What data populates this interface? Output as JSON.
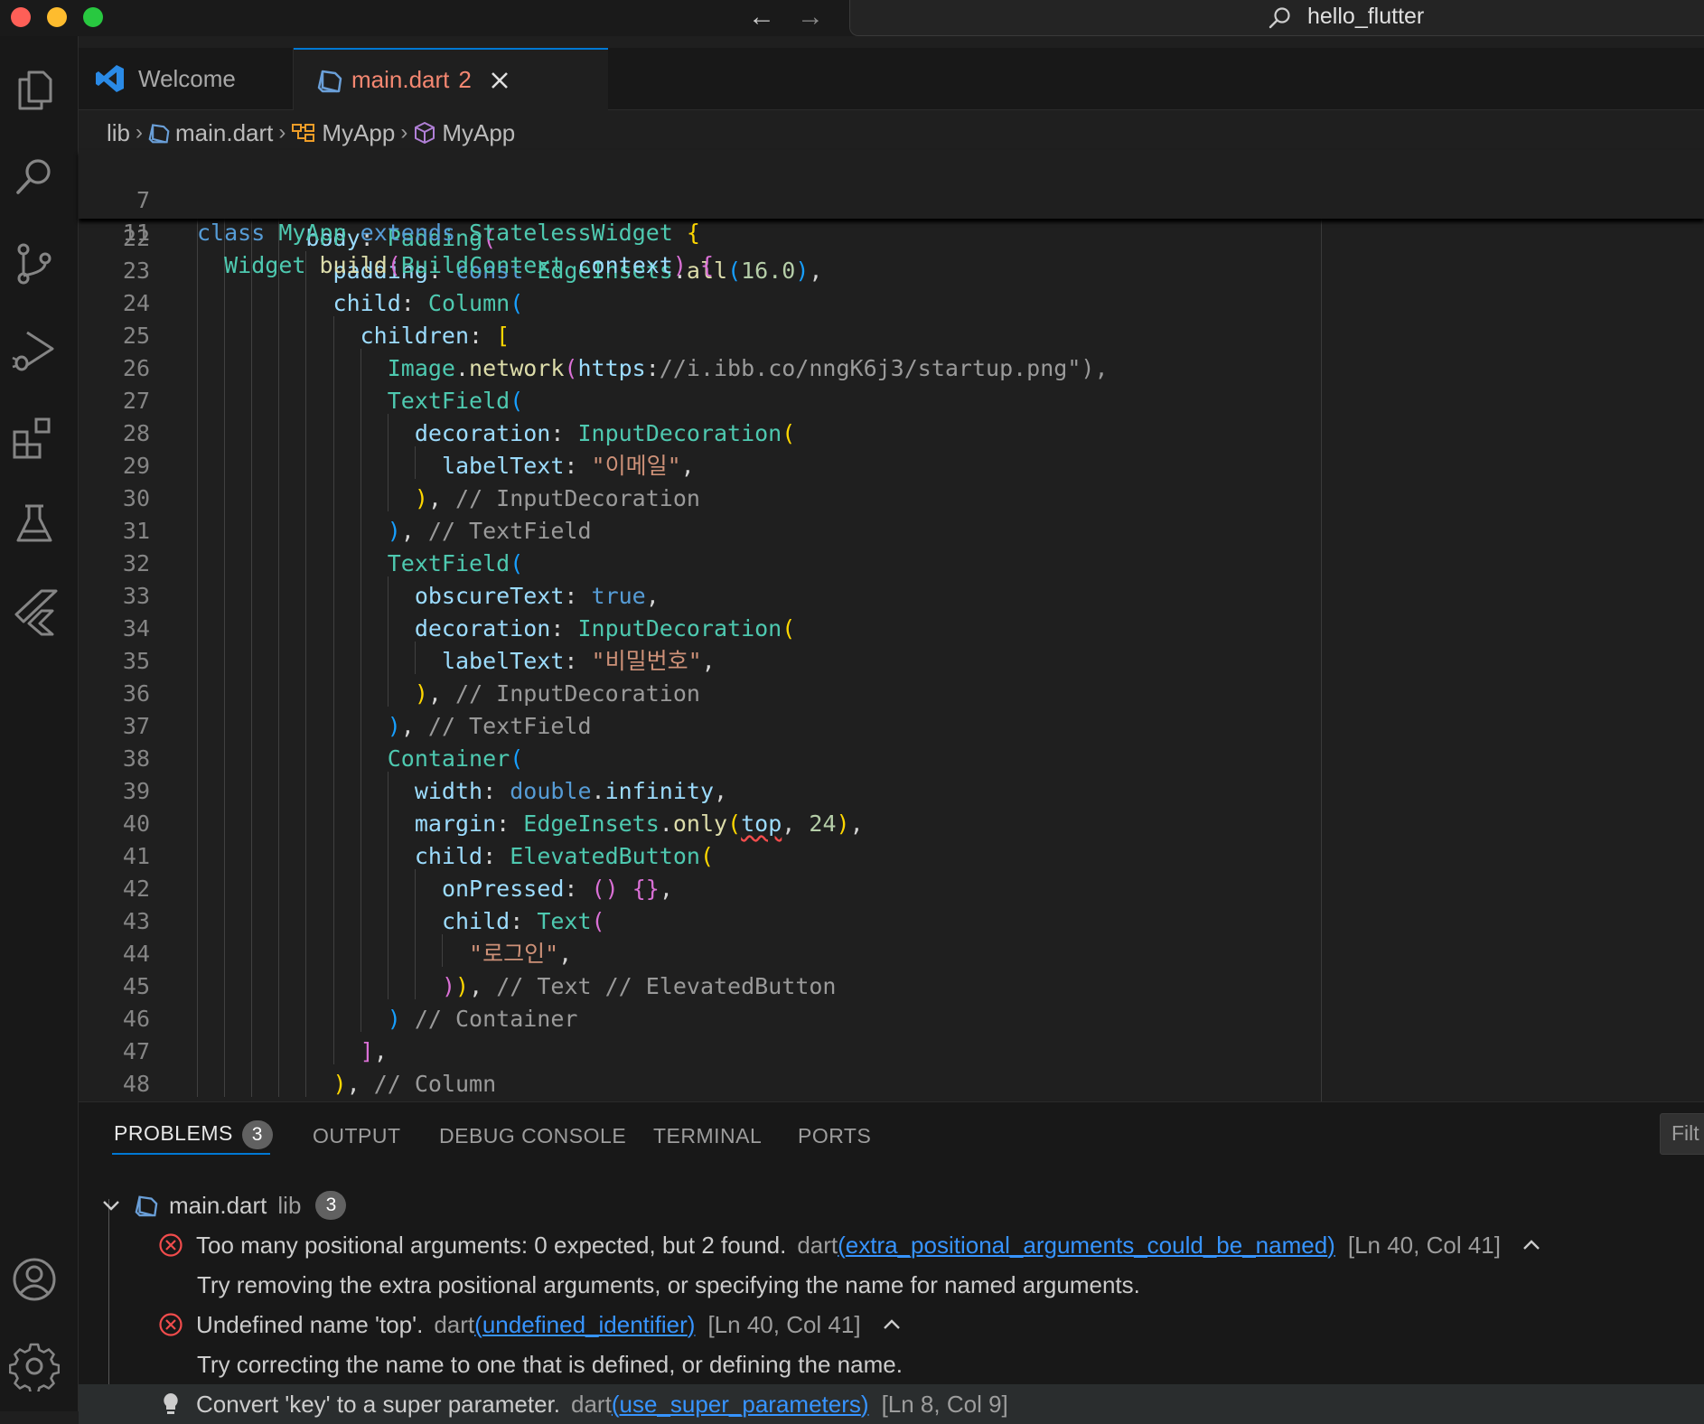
{
  "window": {
    "title": "hello_flutter"
  },
  "colors": {
    "accent": "#0078d4",
    "error": "#f14c4c",
    "link": "#3794ff",
    "close": "#ff5f57",
    "minimize": "#febc2e",
    "maximize": "#28c840"
  },
  "activity_bar": {
    "top": [
      "explorer-icon",
      "search-icon",
      "source-control-icon",
      "run-debug-icon",
      "extensions-icon",
      "testing-icon",
      "flutter-icon"
    ],
    "bottom": [
      "accounts-icon",
      "settings-gear-icon"
    ]
  },
  "tabs": [
    {
      "label": "Welcome",
      "icon": "vscode-icon",
      "active": false
    },
    {
      "label": "main.dart",
      "problems": "2",
      "icon": "dart-icon",
      "active": true
    }
  ],
  "breadcrumb": [
    {
      "label": "lib",
      "icon": ""
    },
    {
      "label": "main.dart",
      "icon": "dart-icon"
    },
    {
      "label": "MyApp",
      "icon": "class-icon"
    },
    {
      "label": "MyApp",
      "icon": "constructor-icon"
    }
  ],
  "editor": {
    "sticky_lines": [
      {
        "num": "7",
        "text": "class MyApp extends StatelessWidget {"
      },
      {
        "num": "11",
        "text": "  Widget build(BuildContext context) {"
      }
    ],
    "lines": [
      {
        "num": "22",
        "text": "        body: Padding("
      },
      {
        "num": "23",
        "text": "          padding: const EdgeInsets.all(16.0),"
      },
      {
        "num": "24",
        "text": "          child: Column("
      },
      {
        "num": "25",
        "text": "            children: ["
      },
      {
        "num": "26",
        "text": "              Image.network(\"https://i.ibb.co/nngK6j3/startup.png\"),"
      },
      {
        "num": "27",
        "text": "              TextField("
      },
      {
        "num": "28",
        "text": "                decoration: InputDecoration("
      },
      {
        "num": "29",
        "text": "                  labelText: \"이메일\","
      },
      {
        "num": "30",
        "text": "                ), // InputDecoration"
      },
      {
        "num": "31",
        "text": "              ), // TextField"
      },
      {
        "num": "32",
        "text": "              TextField("
      },
      {
        "num": "33",
        "text": "                obscureText: true,"
      },
      {
        "num": "34",
        "text": "                decoration: InputDecoration("
      },
      {
        "num": "35",
        "text": "                  labelText: \"비밀번호\","
      },
      {
        "num": "36",
        "text": "                ), // InputDecoration"
      },
      {
        "num": "37",
        "text": "              ), // TextField"
      },
      {
        "num": "38",
        "text": "              Container("
      },
      {
        "num": "39",
        "text": "                width: double.infinity,"
      },
      {
        "num": "40",
        "text": "                margin: EdgeInsets.only(top, 24),"
      },
      {
        "num": "41",
        "text": "                child: ElevatedButton("
      },
      {
        "num": "42",
        "text": "                  onPressed: () {},"
      },
      {
        "num": "43",
        "text": "                  child: Text("
      },
      {
        "num": "44",
        "text": "                    \"로그인\","
      },
      {
        "num": "45",
        "text": "                  )), // Text // ElevatedButton"
      },
      {
        "num": "46",
        "text": "              ) // Container"
      },
      {
        "num": "47",
        "text": "            ],"
      },
      {
        "num": "48",
        "text": "          ), // Column"
      }
    ]
  },
  "panel": {
    "tabs": [
      {
        "label": "PROBLEMS",
        "badge": "3",
        "active": true
      },
      {
        "label": "OUTPUT",
        "active": false
      },
      {
        "label": "DEBUG CONSOLE",
        "active": false
      },
      {
        "label": "TERMINAL",
        "active": false
      },
      {
        "label": "PORTS",
        "active": false
      }
    ],
    "filter_placeholder": "Filt",
    "file_group": {
      "name": "main.dart",
      "folder": "lib",
      "count": "3"
    },
    "problems": [
      {
        "severity": "error",
        "message": "Too many positional arguments: 0 expected, but 2 found.",
        "source": "dart",
        "code": "extra_positional_arguments_could_be_named",
        "location": "[Ln 40, Col 41]",
        "detail": "Try removing the extra positional arguments, or specifying the name for named arguments."
      },
      {
        "severity": "error",
        "message": "Undefined name 'top'.",
        "source": "dart",
        "code": "undefined_identifier",
        "location": "[Ln 40, Col 41]",
        "detail": "Try correcting the name to one that is defined, or defining the name."
      },
      {
        "severity": "info",
        "message": "Convert 'key' to a super parameter.",
        "source": "dart",
        "code": "use_super_parameters",
        "location": "[Ln 8, Col 9]"
      }
    ]
  }
}
